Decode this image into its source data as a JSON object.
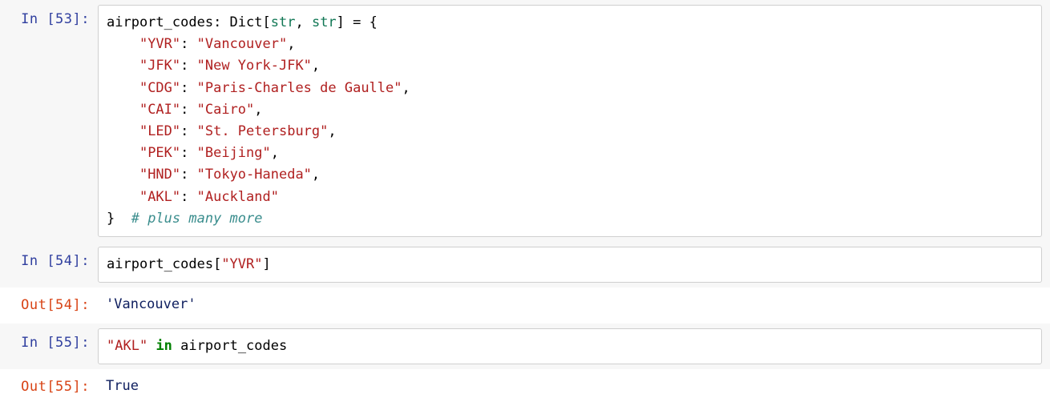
{
  "cells": [
    {
      "in_prompt": "In [53]:",
      "code": {
        "lhs": "airport_codes",
        "type1": "str",
        "type2": "str",
        "dict_label": "Dict",
        "entries": [
          {
            "key": "\"YVR\"",
            "val": "\"Vancouver\""
          },
          {
            "key": "\"JFK\"",
            "val": "\"New York-JFK\""
          },
          {
            "key": "\"CDG\"",
            "val": "\"Paris-Charles de Gaulle\""
          },
          {
            "key": "\"CAI\"",
            "val": "\"Cairo\""
          },
          {
            "key": "\"LED\"",
            "val": "\"St. Petersburg\""
          },
          {
            "key": "\"PEK\"",
            "val": "\"Beijing\""
          },
          {
            "key": "\"HND\"",
            "val": "\"Tokyo-Haneda\""
          },
          {
            "key": "\"AKL\"",
            "val": "\"Auckland\""
          }
        ],
        "comment": "# plus many more"
      }
    },
    {
      "in_prompt": "In [54]:",
      "code2": {
        "var": "airport_codes",
        "key": "\"YVR\""
      },
      "out_prompt": "Out[54]:",
      "output": "'Vancouver'"
    },
    {
      "in_prompt": "In [55]:",
      "code3": {
        "key": "\"AKL\"",
        "kw": "in",
        "var": "airport_codes"
      },
      "out_prompt": "Out[55]:",
      "output": "True"
    }
  ]
}
